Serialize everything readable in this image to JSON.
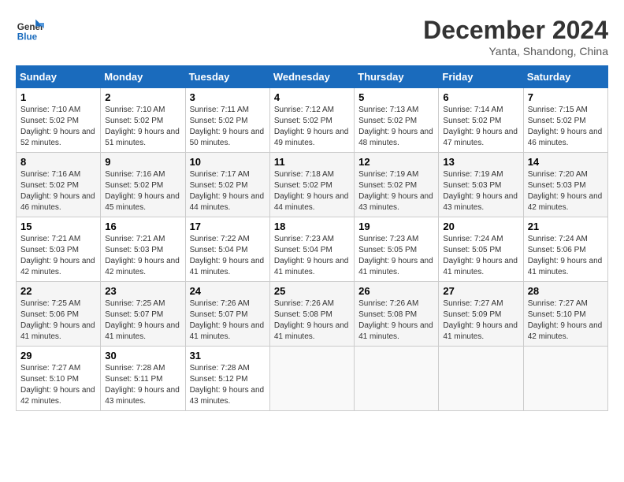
{
  "logo": {
    "line1": "General",
    "line2": "Blue"
  },
  "title": "December 2024",
  "location": "Yanta, Shandong, China",
  "days_of_week": [
    "Sunday",
    "Monday",
    "Tuesday",
    "Wednesday",
    "Thursday",
    "Friday",
    "Saturday"
  ],
  "weeks": [
    [
      {
        "day": "1",
        "sunrise": "7:10 AM",
        "sunset": "5:02 PM",
        "daylight": "9 hours and 52 minutes."
      },
      {
        "day": "2",
        "sunrise": "7:10 AM",
        "sunset": "5:02 PM",
        "daylight": "9 hours and 51 minutes."
      },
      {
        "day": "3",
        "sunrise": "7:11 AM",
        "sunset": "5:02 PM",
        "daylight": "9 hours and 50 minutes."
      },
      {
        "day": "4",
        "sunrise": "7:12 AM",
        "sunset": "5:02 PM",
        "daylight": "9 hours and 49 minutes."
      },
      {
        "day": "5",
        "sunrise": "7:13 AM",
        "sunset": "5:02 PM",
        "daylight": "9 hours and 48 minutes."
      },
      {
        "day": "6",
        "sunrise": "7:14 AM",
        "sunset": "5:02 PM",
        "daylight": "9 hours and 47 minutes."
      },
      {
        "day": "7",
        "sunrise": "7:15 AM",
        "sunset": "5:02 PM",
        "daylight": "9 hours and 46 minutes."
      }
    ],
    [
      {
        "day": "8",
        "sunrise": "7:16 AM",
        "sunset": "5:02 PM",
        "daylight": "9 hours and 46 minutes."
      },
      {
        "day": "9",
        "sunrise": "7:16 AM",
        "sunset": "5:02 PM",
        "daylight": "9 hours and 45 minutes."
      },
      {
        "day": "10",
        "sunrise": "7:17 AM",
        "sunset": "5:02 PM",
        "daylight": "9 hours and 44 minutes."
      },
      {
        "day": "11",
        "sunrise": "7:18 AM",
        "sunset": "5:02 PM",
        "daylight": "9 hours and 44 minutes."
      },
      {
        "day": "12",
        "sunrise": "7:19 AM",
        "sunset": "5:02 PM",
        "daylight": "9 hours and 43 minutes."
      },
      {
        "day": "13",
        "sunrise": "7:19 AM",
        "sunset": "5:03 PM",
        "daylight": "9 hours and 43 minutes."
      },
      {
        "day": "14",
        "sunrise": "7:20 AM",
        "sunset": "5:03 PM",
        "daylight": "9 hours and 42 minutes."
      }
    ],
    [
      {
        "day": "15",
        "sunrise": "7:21 AM",
        "sunset": "5:03 PM",
        "daylight": "9 hours and 42 minutes."
      },
      {
        "day": "16",
        "sunrise": "7:21 AM",
        "sunset": "5:03 PM",
        "daylight": "9 hours and 42 minutes."
      },
      {
        "day": "17",
        "sunrise": "7:22 AM",
        "sunset": "5:04 PM",
        "daylight": "9 hours and 41 minutes."
      },
      {
        "day": "18",
        "sunrise": "7:23 AM",
        "sunset": "5:04 PM",
        "daylight": "9 hours and 41 minutes."
      },
      {
        "day": "19",
        "sunrise": "7:23 AM",
        "sunset": "5:05 PM",
        "daylight": "9 hours and 41 minutes."
      },
      {
        "day": "20",
        "sunrise": "7:24 AM",
        "sunset": "5:05 PM",
        "daylight": "9 hours and 41 minutes."
      },
      {
        "day": "21",
        "sunrise": "7:24 AM",
        "sunset": "5:06 PM",
        "daylight": "9 hours and 41 minutes."
      }
    ],
    [
      {
        "day": "22",
        "sunrise": "7:25 AM",
        "sunset": "5:06 PM",
        "daylight": "9 hours and 41 minutes."
      },
      {
        "day": "23",
        "sunrise": "7:25 AM",
        "sunset": "5:07 PM",
        "daylight": "9 hours and 41 minutes."
      },
      {
        "day": "24",
        "sunrise": "7:26 AM",
        "sunset": "5:07 PM",
        "daylight": "9 hours and 41 minutes."
      },
      {
        "day": "25",
        "sunrise": "7:26 AM",
        "sunset": "5:08 PM",
        "daylight": "9 hours and 41 minutes."
      },
      {
        "day": "26",
        "sunrise": "7:26 AM",
        "sunset": "5:08 PM",
        "daylight": "9 hours and 41 minutes."
      },
      {
        "day": "27",
        "sunrise": "7:27 AM",
        "sunset": "5:09 PM",
        "daylight": "9 hours and 41 minutes."
      },
      {
        "day": "28",
        "sunrise": "7:27 AM",
        "sunset": "5:10 PM",
        "daylight": "9 hours and 42 minutes."
      }
    ],
    [
      {
        "day": "29",
        "sunrise": "7:27 AM",
        "sunset": "5:10 PM",
        "daylight": "9 hours and 42 minutes."
      },
      {
        "day": "30",
        "sunrise": "7:28 AM",
        "sunset": "5:11 PM",
        "daylight": "9 hours and 43 minutes."
      },
      {
        "day": "31",
        "sunrise": "7:28 AM",
        "sunset": "5:12 PM",
        "daylight": "9 hours and 43 minutes."
      },
      null,
      null,
      null,
      null
    ]
  ]
}
